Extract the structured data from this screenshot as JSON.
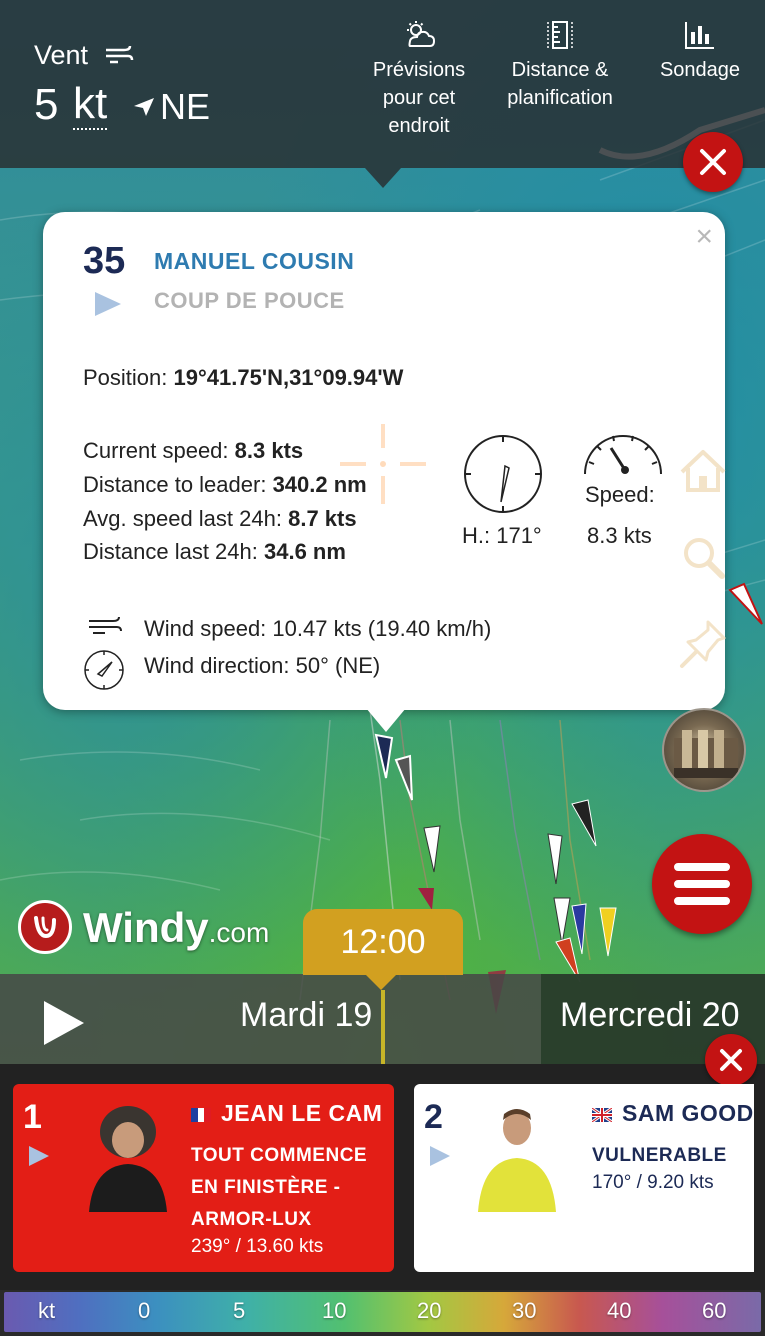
{
  "topbar": {
    "wind_label": "Vent",
    "wind_value": "5",
    "wind_unit": "kt",
    "wind_direction": "NE",
    "actions": [
      {
        "label_lines": [
          "Prévisions",
          "pour cet",
          "endroit"
        ],
        "icon": "cloud-sun-icon"
      },
      {
        "label_lines": [
          "Distance &",
          "planification"
        ],
        "icon": "ruler-icon"
      },
      {
        "label_lines": [
          "Sondage"
        ],
        "icon": "bar-chart-icon"
      }
    ]
  },
  "popup": {
    "rank": "35",
    "skipper": "MANUEL COUSIN",
    "boat": "COUP DE POUCE",
    "position_label": "Position:",
    "position_value": "19°41.75'N,31°09.94'W",
    "stats": [
      {
        "label": "Current speed:",
        "value": "8.3 kts"
      },
      {
        "label": "Distance to leader:",
        "value": "340.2 nm"
      },
      {
        "label": "Avg. speed last 24h:",
        "value": "8.7 kts"
      },
      {
        "label": "Distance last 24h:",
        "value": "34.6 nm"
      }
    ],
    "heading_text": "H.: 171°",
    "speed_label": "Speed:",
    "speed_value": "8.3 kts",
    "wind_speed_text": "Wind speed: 10.47 kts (19.40 km/h)",
    "wind_dir_text": "Wind direction: 50° (NE)",
    "close_symbol": "×"
  },
  "logo": {
    "text": "Windy",
    "suffix": ".com"
  },
  "timeline": {
    "time": "12:00",
    "day_current": "Mardi 19",
    "day_next": "Mercredi 20"
  },
  "leaders": [
    {
      "rank": "1",
      "flag": "FR",
      "name": "JEAN LE CAM",
      "boat_lines": [
        "TOUT COMMENCE",
        "EN FINISTÈRE -",
        "ARMOR-LUX"
      ],
      "stat": "239° / 13.60 kts"
    },
    {
      "rank": "2",
      "flag": "GB",
      "name": "SAM GOOD",
      "boat_lines": [
        "VULNERABLE"
      ],
      "stat": "170° / 9.20 kts"
    }
  ],
  "legend": {
    "unit": "kt",
    "ticks": [
      "0",
      "5",
      "10",
      "20",
      "30",
      "40",
      "60"
    ]
  },
  "colors": {
    "accent_red": "#c31313",
    "timeline_gold": "#d2a020",
    "skipper_blue": "#2e7bb0",
    "rank_navy": "#1c2a55"
  }
}
